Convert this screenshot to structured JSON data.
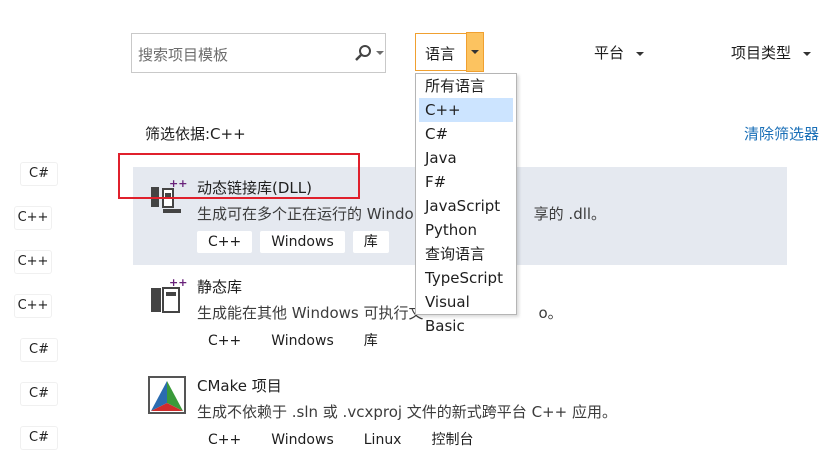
{
  "search": {
    "placeholder": "搜索项目模板"
  },
  "filters": {
    "language": "语言",
    "platform": "平台",
    "project_type": "项目类型"
  },
  "language_options": [
    "所有语言",
    "C++",
    "C#",
    "Java",
    "F#",
    "JavaScript",
    "Python",
    "查询语言",
    "TypeScript",
    "Visual Basic"
  ],
  "language_selected": "C++",
  "filter_by": "筛选依据:C++",
  "clear_filters": "清除筛选器",
  "left_tags": [
    "C#",
    "C++",
    "C++",
    "C++",
    "C#",
    "C#",
    "C#"
  ],
  "projects": [
    {
      "title": "动态链接库(DLL)",
      "desc": "生成可在多个正在运行的 Windo",
      "desc_tail": "享的 .dll。",
      "tags": [
        "C++",
        "Windows",
        "库"
      ]
    },
    {
      "title": "静态库",
      "desc": "生成能在其他 Windows 可执行文",
      "desc_tail": "o。",
      "tags": [
        "C++",
        "Windows",
        "库"
      ]
    },
    {
      "title": "CMake 项目",
      "desc": "生成不依赖于 .sln 或 .vcxproj 文件的新式跨平台 C++ 应用。",
      "tags": [
        "C++",
        "Windows",
        "Linux",
        "控制台"
      ]
    }
  ],
  "colors": {
    "accent_orange": "#fcc360",
    "link_blue": "#1a6fb7",
    "highlight_red": "#e0202c",
    "selected_row": "#e5e9f0"
  }
}
